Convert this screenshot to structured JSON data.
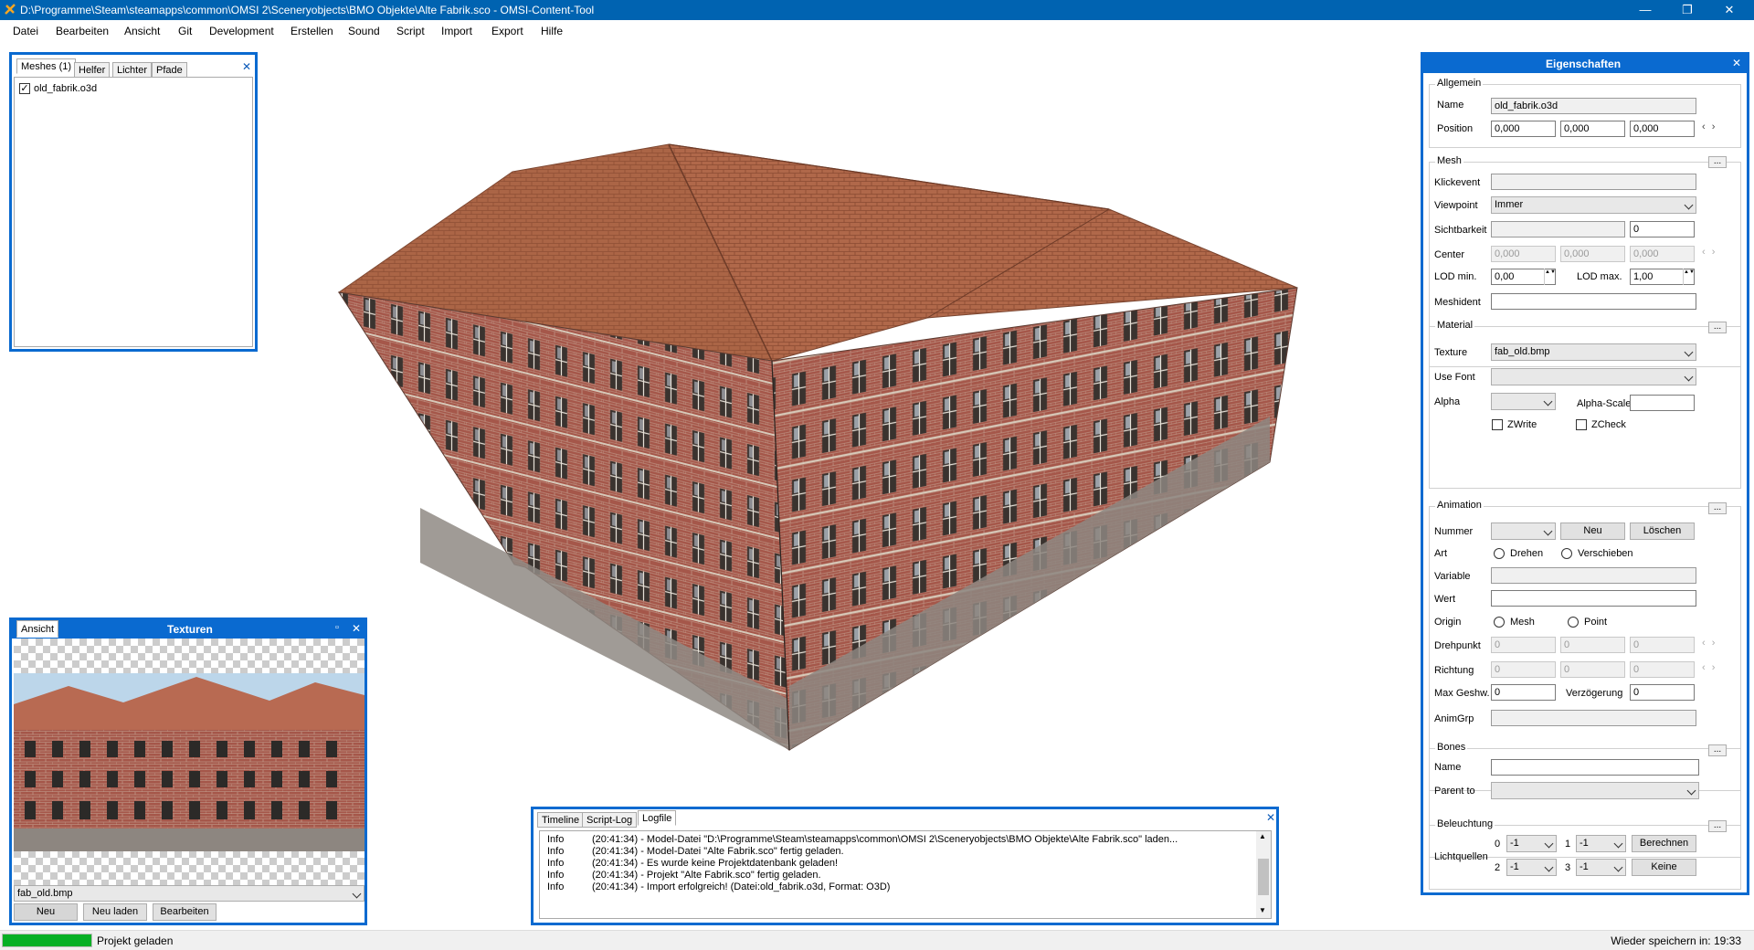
{
  "window": {
    "title": "D:\\Programme\\Steam\\steamapps\\common\\OMSI 2\\Sceneryobjects\\BMO Objekte\\Alte Fabrik.sco - OMSI-Content-Tool",
    "minimize": "—",
    "maximize": "❐",
    "close": "✕"
  },
  "menu": [
    "Datei",
    "Bearbeiten",
    "Ansicht",
    "Git",
    "Development",
    "Erstellen",
    "Sound",
    "Script",
    "Import",
    "Export",
    "Hilfe"
  ],
  "meshes_panel": {
    "tabs": [
      "Meshes (1)",
      "Helfer",
      "Lichter",
      "Pfade"
    ],
    "items": [
      {
        "label": "old_fabrik.o3d",
        "checked": "✓"
      }
    ]
  },
  "texture_panel": {
    "title": "Texturen",
    "view_tab": "Ansicht",
    "selected": "fab_old.bmp",
    "buttons": {
      "new": "Neu",
      "reload": "Neu laden",
      "edit": "Bearbeiten"
    },
    "pin": "▫"
  },
  "props": {
    "title": "Eigenschaften",
    "allgemein": {
      "group": "Allgemein",
      "name_label": "Name",
      "name_value": "old_fabrik.o3d",
      "position_label": "Position",
      "position": [
        "0,000",
        "0,000",
        "0,000"
      ],
      "arrows": "‹ ›"
    },
    "mesh": {
      "group": "Mesh",
      "collapse": "...",
      "klickevent_label": "Klickevent",
      "viewpoint_label": "Viewpoint",
      "viewpoint_value": "Immer",
      "sichtbarkeit_label": "Sichtbarkeit",
      "sichtbarkeit_value": "0",
      "center_label": "Center",
      "center": [
        "0,000",
        "0,000",
        "0,000"
      ],
      "lodmin_label": "LOD min.",
      "lodmin_value": "0,00",
      "lodmax_label": "LOD max.",
      "lodmax_value": "1,00",
      "meshident_label": "Meshident",
      "spin": "▲▼"
    },
    "material": {
      "group": "Material",
      "texture_label": "Texture",
      "texture_value": "fab_old.bmp",
      "usefont_label": "Use Font",
      "alpha_label": "Alpha",
      "alphascale_label": "Alpha-Scale",
      "zwrite_label": "ZWrite",
      "zcheck_label": "ZCheck"
    },
    "animation": {
      "group": "Animation",
      "nummer_label": "Nummer",
      "neu_button": "Neu",
      "loeschen_button": "Löschen",
      "art_label": "Art",
      "drehen_label": "Drehen",
      "verschieben_label": "Verschieben",
      "variable_label": "Variable",
      "wert_label": "Wert",
      "origin_label": "Origin",
      "origin_mesh": "Mesh",
      "origin_point": "Point",
      "drehpunkt_label": "Drehpunkt",
      "drehpunkt": [
        "0",
        "0",
        "0"
      ],
      "richtung_label": "Richtung",
      "richtung": [
        "0",
        "0",
        "0"
      ],
      "maxgeshw_label": "Max Geshw.",
      "maxgeshw_value": "0",
      "verzoegerung_label": "Verzögerung",
      "verzoegerung_value": "0",
      "animgrp_label": "AnimGrp"
    },
    "bones": {
      "group": "Bones",
      "name_label": "Name",
      "parent_label": "Parent to"
    },
    "beleuchtung": {
      "group": "Beleuchtung",
      "lichtquellen_label": "Lichtquellen",
      "idx": [
        "0",
        "1",
        "2",
        "3"
      ],
      "values": [
        "-1",
        "-1",
        "-1",
        "-1"
      ],
      "berechnen_button": "Berechnen",
      "keine_button": "Keine"
    }
  },
  "log_panel": {
    "tabs": [
      "Timeline",
      "Script-Log",
      "Logfile"
    ],
    "rows": [
      {
        "level": "Info",
        "text": "(20:41:34) - Model-Datei \"D:\\Programme\\Steam\\steamapps\\common\\OMSI 2\\Sceneryobjects\\BMO Objekte\\Alte Fabrik.sco\" laden..."
      },
      {
        "level": "Info",
        "text": "(20:41:34) - Model-Datei \"Alte Fabrik.sco\" fertig geladen."
      },
      {
        "level": "Info",
        "text": "(20:41:34) - Es wurde keine Projektdatenbank geladen!"
      },
      {
        "level": "Info",
        "text": "(20:41:34) - Projekt \"Alte Fabrik.sco\" fertig geladen."
      },
      {
        "level": "Info",
        "text": "(20:41:34) - Import erfolgreich! (Datei:old_fabrik.o3d, Format: O3D)"
      }
    ]
  },
  "status": {
    "progress": 1.0,
    "text": "Projekt geladen",
    "autosave": "Wieder speichern in: 19:33"
  },
  "colors": {
    "accent": "#0a6ad0",
    "titlebar": "#0063b1",
    "progress": "#06b025"
  }
}
